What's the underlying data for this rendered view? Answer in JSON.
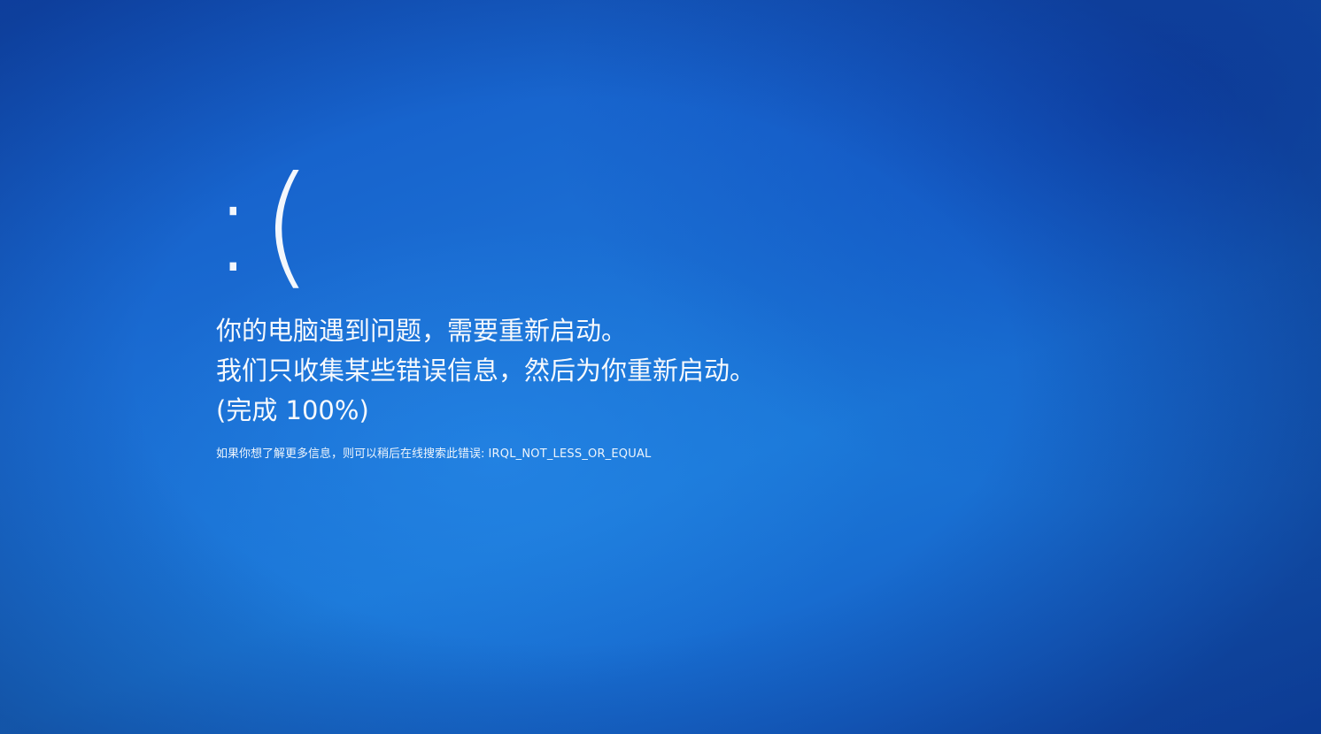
{
  "screen": {
    "sad_face": ":(",
    "messages": [
      "你的电脑遇到问题，需要重新启动。",
      "我们只收集某些错误信息，然后为你重新启动。"
    ],
    "progress_text": "(完成 100%)",
    "progress_percent": 100,
    "info_prefix": "如果你想了解更多信息，则可以稍后在线搜索此错误: ",
    "stop_code": "IRQL_NOT_LESS_OR_EQUAL",
    "background_color": "#1a6fd0",
    "text_color": "#ffffff"
  }
}
